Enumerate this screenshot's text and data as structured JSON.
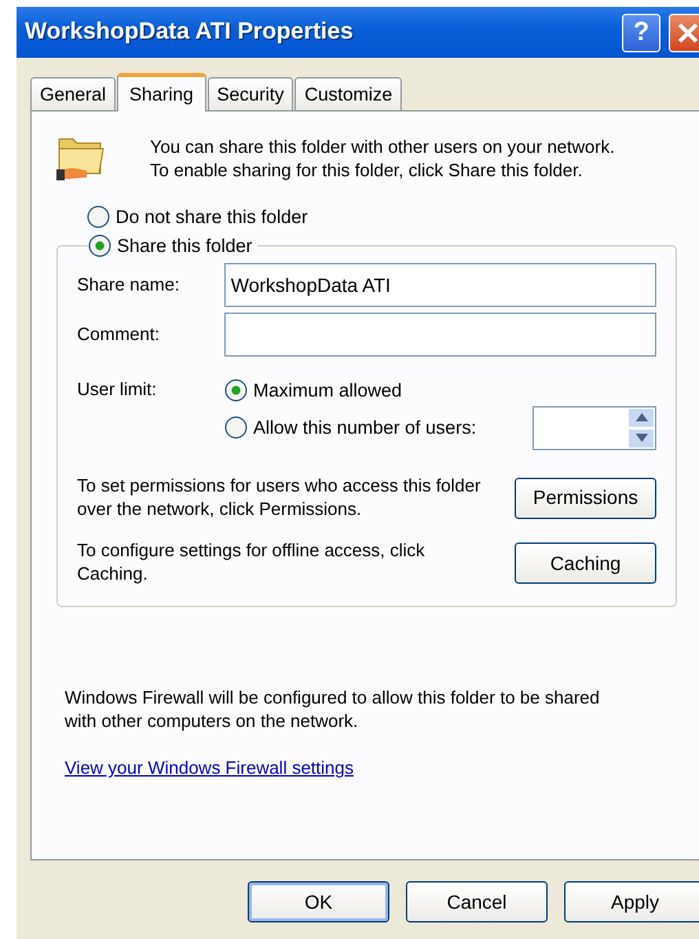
{
  "window": {
    "title": "WorkshopData ATI Properties",
    "help_button": "?"
  },
  "tabs": [
    {
      "label": "General",
      "selected": false
    },
    {
      "label": "Sharing",
      "selected": true
    },
    {
      "label": "Security",
      "selected": false
    },
    {
      "label": "Customize",
      "selected": false
    }
  ],
  "intro": "You can share this folder with other users on your network.  To enable sharing for this folder, click Share this folder.",
  "share_options": [
    {
      "label": "Do not share this folder",
      "selected": false
    },
    {
      "label": "Share this folder",
      "selected": true
    }
  ],
  "share_name": {
    "label": "Share name:",
    "value": "WorkshopData ATI"
  },
  "comment": {
    "label": "Comment:"
  },
  "user_limit": {
    "label": "User limit:",
    "options": [
      {
        "label": "Maximum allowed",
        "selected": true
      },
      {
        "label": "Allow this number of users:",
        "selected": false
      }
    ]
  },
  "actions": [
    {
      "text": "To set permissions for users who access this folder over the network, click Permissions.",
      "button": "Permissions"
    },
    {
      "text": "To configure settings for offline access, click Caching.",
      "button": "Caching"
    }
  ],
  "firewall_note": "Windows Firewall will be configured to allow this folder to be shared with other computers on the network.",
  "firewall_link": "View your Windows Firewall settings",
  "buttons": [
    {
      "label": "OK",
      "default": true
    },
    {
      "label": "Cancel",
      "default": false
    },
    {
      "label": "Apply",
      "default": false
    }
  ]
}
